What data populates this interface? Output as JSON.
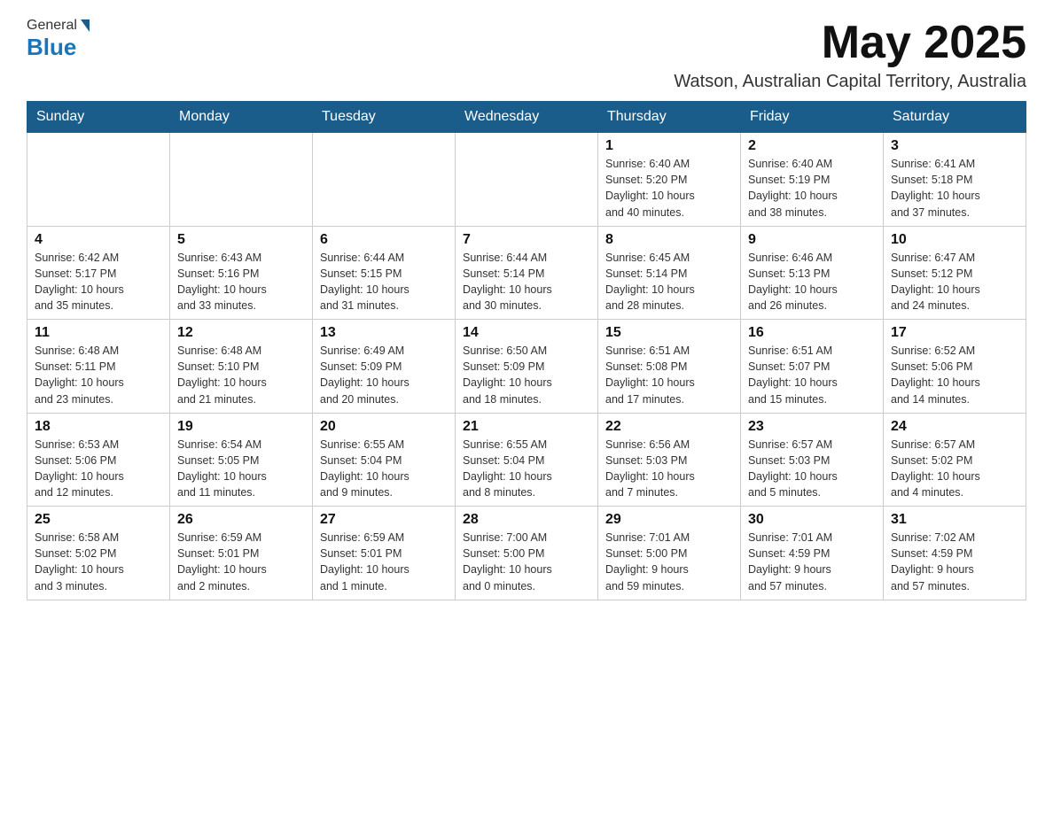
{
  "header": {
    "logo_general": "General",
    "logo_blue": "Blue",
    "month_title": "May 2025",
    "location": "Watson, Australian Capital Territory, Australia"
  },
  "weekdays": [
    "Sunday",
    "Monday",
    "Tuesday",
    "Wednesday",
    "Thursday",
    "Friday",
    "Saturday"
  ],
  "weeks": [
    [
      {
        "day": "",
        "info": ""
      },
      {
        "day": "",
        "info": ""
      },
      {
        "day": "",
        "info": ""
      },
      {
        "day": "",
        "info": ""
      },
      {
        "day": "1",
        "info": "Sunrise: 6:40 AM\nSunset: 5:20 PM\nDaylight: 10 hours\nand 40 minutes."
      },
      {
        "day": "2",
        "info": "Sunrise: 6:40 AM\nSunset: 5:19 PM\nDaylight: 10 hours\nand 38 minutes."
      },
      {
        "day": "3",
        "info": "Sunrise: 6:41 AM\nSunset: 5:18 PM\nDaylight: 10 hours\nand 37 minutes."
      }
    ],
    [
      {
        "day": "4",
        "info": "Sunrise: 6:42 AM\nSunset: 5:17 PM\nDaylight: 10 hours\nand 35 minutes."
      },
      {
        "day": "5",
        "info": "Sunrise: 6:43 AM\nSunset: 5:16 PM\nDaylight: 10 hours\nand 33 minutes."
      },
      {
        "day": "6",
        "info": "Sunrise: 6:44 AM\nSunset: 5:15 PM\nDaylight: 10 hours\nand 31 minutes."
      },
      {
        "day": "7",
        "info": "Sunrise: 6:44 AM\nSunset: 5:14 PM\nDaylight: 10 hours\nand 30 minutes."
      },
      {
        "day": "8",
        "info": "Sunrise: 6:45 AM\nSunset: 5:14 PM\nDaylight: 10 hours\nand 28 minutes."
      },
      {
        "day": "9",
        "info": "Sunrise: 6:46 AM\nSunset: 5:13 PM\nDaylight: 10 hours\nand 26 minutes."
      },
      {
        "day": "10",
        "info": "Sunrise: 6:47 AM\nSunset: 5:12 PM\nDaylight: 10 hours\nand 24 minutes."
      }
    ],
    [
      {
        "day": "11",
        "info": "Sunrise: 6:48 AM\nSunset: 5:11 PM\nDaylight: 10 hours\nand 23 minutes."
      },
      {
        "day": "12",
        "info": "Sunrise: 6:48 AM\nSunset: 5:10 PM\nDaylight: 10 hours\nand 21 minutes."
      },
      {
        "day": "13",
        "info": "Sunrise: 6:49 AM\nSunset: 5:09 PM\nDaylight: 10 hours\nand 20 minutes."
      },
      {
        "day": "14",
        "info": "Sunrise: 6:50 AM\nSunset: 5:09 PM\nDaylight: 10 hours\nand 18 minutes."
      },
      {
        "day": "15",
        "info": "Sunrise: 6:51 AM\nSunset: 5:08 PM\nDaylight: 10 hours\nand 17 minutes."
      },
      {
        "day": "16",
        "info": "Sunrise: 6:51 AM\nSunset: 5:07 PM\nDaylight: 10 hours\nand 15 minutes."
      },
      {
        "day": "17",
        "info": "Sunrise: 6:52 AM\nSunset: 5:06 PM\nDaylight: 10 hours\nand 14 minutes."
      }
    ],
    [
      {
        "day": "18",
        "info": "Sunrise: 6:53 AM\nSunset: 5:06 PM\nDaylight: 10 hours\nand 12 minutes."
      },
      {
        "day": "19",
        "info": "Sunrise: 6:54 AM\nSunset: 5:05 PM\nDaylight: 10 hours\nand 11 minutes."
      },
      {
        "day": "20",
        "info": "Sunrise: 6:55 AM\nSunset: 5:04 PM\nDaylight: 10 hours\nand 9 minutes."
      },
      {
        "day": "21",
        "info": "Sunrise: 6:55 AM\nSunset: 5:04 PM\nDaylight: 10 hours\nand 8 minutes."
      },
      {
        "day": "22",
        "info": "Sunrise: 6:56 AM\nSunset: 5:03 PM\nDaylight: 10 hours\nand 7 minutes."
      },
      {
        "day": "23",
        "info": "Sunrise: 6:57 AM\nSunset: 5:03 PM\nDaylight: 10 hours\nand 5 minutes."
      },
      {
        "day": "24",
        "info": "Sunrise: 6:57 AM\nSunset: 5:02 PM\nDaylight: 10 hours\nand 4 minutes."
      }
    ],
    [
      {
        "day": "25",
        "info": "Sunrise: 6:58 AM\nSunset: 5:02 PM\nDaylight: 10 hours\nand 3 minutes."
      },
      {
        "day": "26",
        "info": "Sunrise: 6:59 AM\nSunset: 5:01 PM\nDaylight: 10 hours\nand 2 minutes."
      },
      {
        "day": "27",
        "info": "Sunrise: 6:59 AM\nSunset: 5:01 PM\nDaylight: 10 hours\nand 1 minute."
      },
      {
        "day": "28",
        "info": "Sunrise: 7:00 AM\nSunset: 5:00 PM\nDaylight: 10 hours\nand 0 minutes."
      },
      {
        "day": "29",
        "info": "Sunrise: 7:01 AM\nSunset: 5:00 PM\nDaylight: 9 hours\nand 59 minutes."
      },
      {
        "day": "30",
        "info": "Sunrise: 7:01 AM\nSunset: 4:59 PM\nDaylight: 9 hours\nand 57 minutes."
      },
      {
        "day": "31",
        "info": "Sunrise: 7:02 AM\nSunset: 4:59 PM\nDaylight: 9 hours\nand 57 minutes."
      }
    ]
  ]
}
